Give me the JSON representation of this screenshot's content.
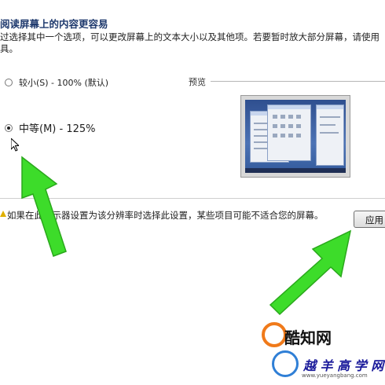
{
  "section": {
    "title": "阅读屏幕上的内容更容易",
    "description": "过选择其中一个选项，可以更改屏幕上的文本大小以及其他项。若要暂时放大部分屏幕，请使用具。"
  },
  "options": [
    {
      "label": "较小(S) - 100% (默认)",
      "selected": false
    },
    {
      "label": "中等(M) - 125%",
      "selected": true
    }
  ],
  "preview": {
    "label": "预览"
  },
  "warning": {
    "text": "如果在此显示器设置为该分辨率时选择此设置，某些项目可能不适合您的屏幕。"
  },
  "buttons": {
    "apply": "应用"
  },
  "watermark": {
    "brand1": "酷知网",
    "brand2": "越 羊 高 学 网",
    "url": "www.yueyangbang.com"
  },
  "colors": {
    "arrow": "#3ddc2a",
    "title": "#1f3a6e",
    "screen": "#2f4f8f"
  }
}
